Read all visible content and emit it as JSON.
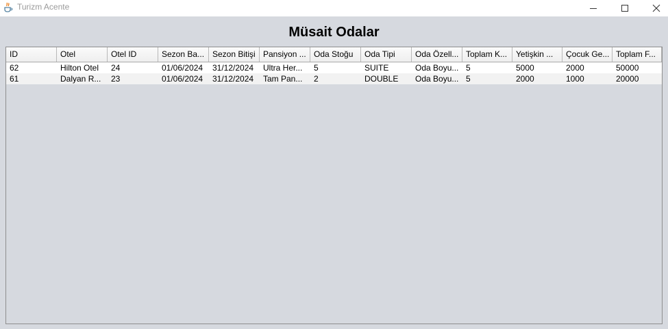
{
  "window": {
    "title": "Turizm Acente",
    "icons": {
      "app": "java-cup-icon",
      "minimize": "minimize-icon",
      "maximize": "maximize-icon",
      "close": "close-icon"
    }
  },
  "page": {
    "heading": "Müsait Odalar"
  },
  "table": {
    "columns": [
      "ID",
      "Otel",
      "Otel ID",
      "Sezon Ba...",
      "Sezon Bitişi",
      "Pansiyon ...",
      "Oda Stoğu",
      "Oda Tipi",
      "Oda Özell...",
      "Toplam K...",
      "Yetişkin ...",
      "Çocuk Ge...",
      "Toplam F..."
    ],
    "rows": [
      [
        "62",
        "Hilton Otel",
        "24",
        "01/06/2024",
        "31/12/2024",
        "Ultra Her...",
        "5",
        "SUITE",
        "Oda Boyu...",
        "5",
        "5000",
        "2000",
        "50000"
      ],
      [
        "61",
        "Dalyan R...",
        "23",
        "01/06/2024",
        "31/12/2024",
        "Tam Pan...",
        "2",
        "DOUBLE",
        "Oda Boyu...",
        "5",
        "2000",
        "1000",
        "20000"
      ]
    ]
  }
}
